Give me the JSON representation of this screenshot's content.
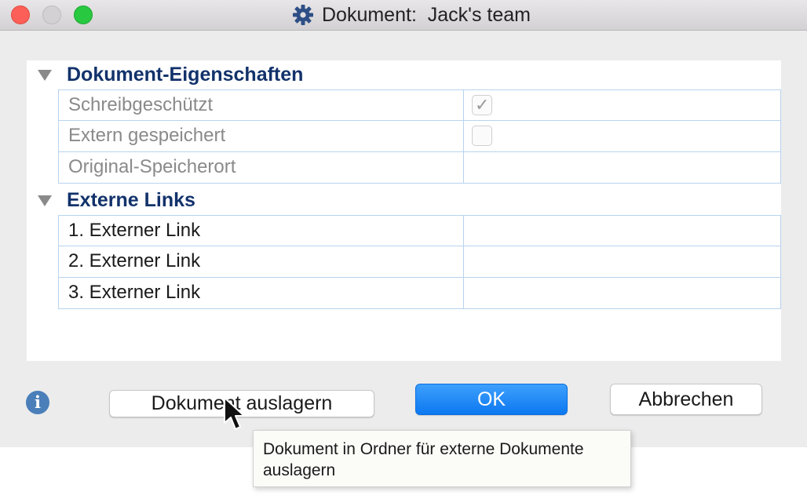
{
  "window": {
    "title": "Dokument:  Jack's team"
  },
  "icons": {
    "title": "gear-icon",
    "info": "info-icon",
    "expand": "disclosure-triangle-icon",
    "cursor": "mouse-pointer-icon"
  },
  "sections": [
    {
      "title": "Dokument-Eigenschaften",
      "rows": [
        {
          "label": "Schreibgeschützt",
          "checkbox": true,
          "checked": true
        },
        {
          "label": "Extern gespeichert",
          "checkbox": true,
          "checked": false
        },
        {
          "label": "Original-Speicherort",
          "value": ""
        }
      ]
    },
    {
      "title": "Externe Links",
      "rows": [
        {
          "label": "1. Externer Link",
          "value": ""
        },
        {
          "label": "2. Externer Link",
          "value": ""
        },
        {
          "label": "3. Externer Link",
          "value": ""
        }
      ]
    }
  ],
  "checkmark_glyph": "✓",
  "info_glyph": "i",
  "buttons": {
    "externalize": "Dokument auslagern",
    "ok": "OK",
    "cancel": "Abbrechen"
  },
  "tooltip": {
    "text": "Dokument in Ordner für externe Dokumente auslagern"
  },
  "colors": {
    "section_title": "#12326b",
    "grid_border": "#b7d3ef",
    "ok_button": "#0c78f0",
    "info_icon": "#4a7fb9"
  }
}
